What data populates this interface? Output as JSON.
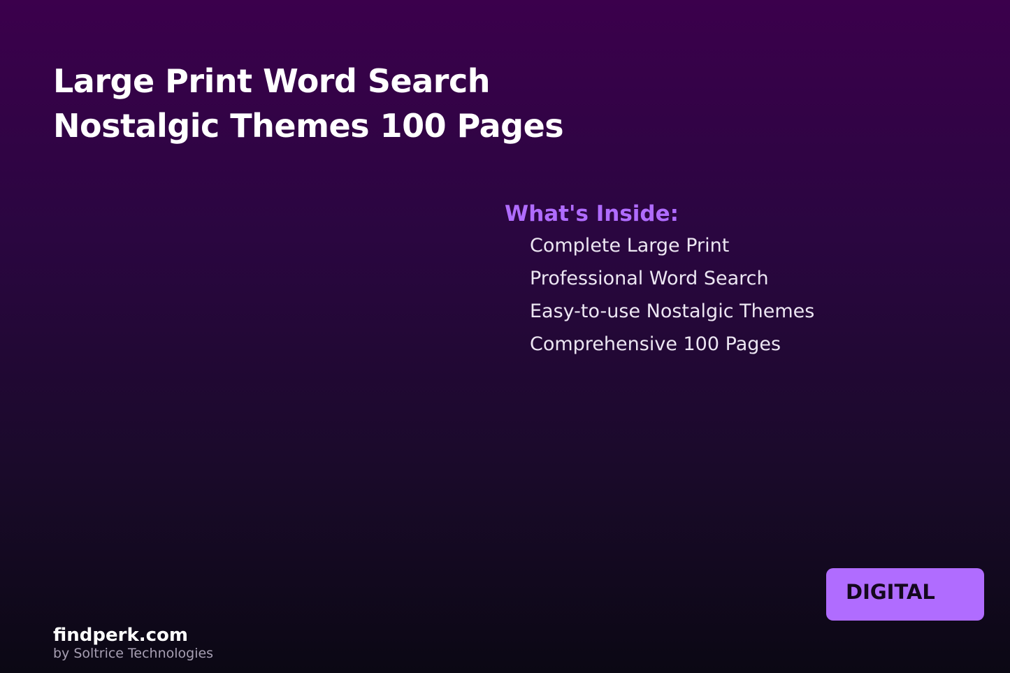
{
  "title": {
    "line1": "Large Print Word Search",
    "line2": "Nostalgic Themes 100 Pages"
  },
  "inside": {
    "heading": "What's Inside:",
    "items": [
      "Complete Large Print",
      "Professional Word Search",
      "Easy-to-use Nostalgic Themes",
      "Comprehensive 100 Pages"
    ]
  },
  "badge": {
    "label": "DIGITAL"
  },
  "brand": {
    "name": "findperk.com",
    "byline": "by Soltrice Technologies"
  },
  "colors": {
    "accent": "#b06cff",
    "background_top": "#3b004c",
    "background_bottom": "#0b0814"
  }
}
